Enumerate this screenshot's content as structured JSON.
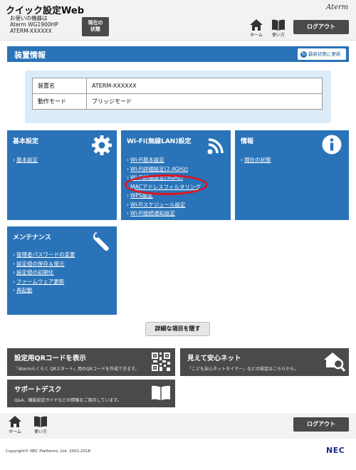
{
  "header": {
    "app_title": "クイック設定Web",
    "device_lines": [
      "お使いの機器は",
      "Aterm WG1900HP",
      "ATERM-XXXXXX"
    ],
    "status_button_lines": [
      "現在の",
      "状態"
    ],
    "brand": "Aterm",
    "home_label": "ホーム",
    "manual_label": "使い方",
    "logout_label": "ログアウト"
  },
  "section": {
    "title": "装置情報",
    "refresh_label": "最新状態に更新"
  },
  "info_table": [
    {
      "key": "装置名",
      "value": "ATERM-XXXXXX"
    },
    {
      "key": "動作モード",
      "value": "ブリッジモード"
    }
  ],
  "cards": {
    "basic": {
      "title": "基本設定",
      "links": [
        "基本設定"
      ]
    },
    "wifi": {
      "title": "Wi-Fi(無線LAN)設定",
      "links": [
        "Wi-Fi基本設定",
        "Wi-Fi詳細設定(2.4GHz)",
        "Wi-Fi詳細設定(5GHz)",
        "MACアドレスフィルタリング",
        "WPS設定",
        "Wi-Fiスケジュール設定",
        "Wi-Fi接続通知設定"
      ]
    },
    "info": {
      "title": "情報",
      "links": [
        "現在の状態"
      ]
    },
    "maintenance": {
      "title": "メンテナンス",
      "links": [
        "管理者パスワードの変更",
        "設定値の保存＆復元",
        "設定値の初期化",
        "ファームウェア更新",
        "再起動"
      ]
    }
  },
  "detail_button": "詳細な項目を隠す",
  "banners": {
    "qr": {
      "title": "設定用QRコードを表示",
      "desc": "「Atermらくらく QRスタート」用のQRコードを作成できます。"
    },
    "safe_net": {
      "title": "見えて安心ネット",
      "desc": "「こども安心ネットタイマー」などの設定はこちらから。"
    },
    "support": {
      "title": "サポートデスク",
      "desc": "Q&A、機能設定ガイドなどの情報をご案内しています。"
    }
  },
  "footer": {
    "home_label": "ホーム",
    "manual_label": "使い方",
    "logout_label": "ログアウト",
    "copyright": "Copyright© NEC Platforms, Ltd. 2001-2018",
    "company_logo": "NEC"
  },
  "colors": {
    "primary_blue": "#2a73b8",
    "dark_gray": "#4a4a4a",
    "highlight_red": "#e0141e",
    "light_blue_bg": "#dcebf8"
  }
}
